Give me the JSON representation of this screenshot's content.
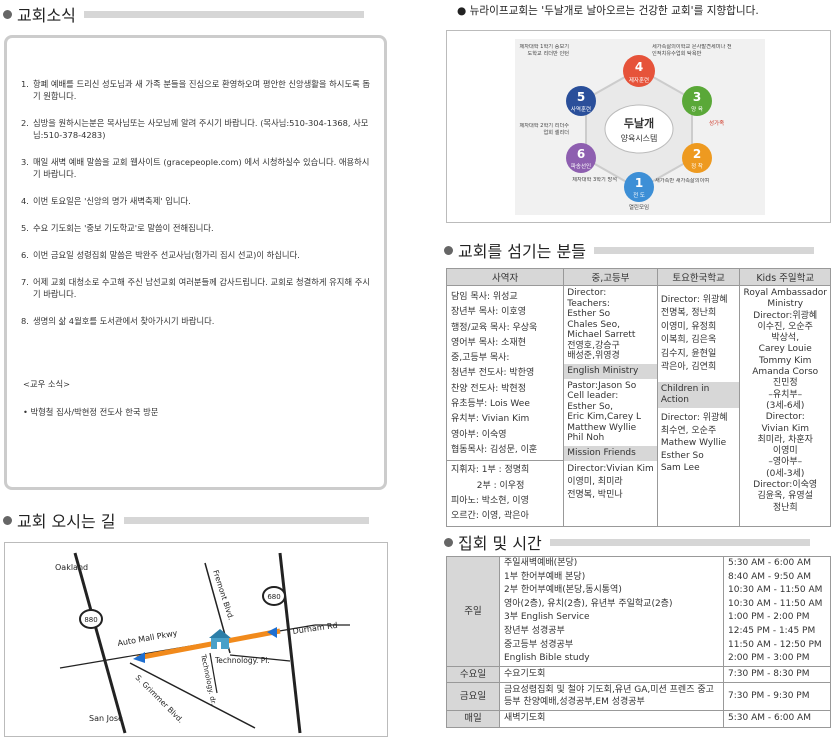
{
  "notices": {
    "title": "교회소식",
    "items": [
      {
        "num": "1.",
        "text": "항폐 예배를 드리신 성도님과 새 가족 분들을 진심으로 환영하오며 평안한 신앙생활을 하시도록 돕기 원합니다."
      },
      {
        "num": "2.",
        "text": "심방을 원하시는분은 목사님또는 사모님께 알려 주시기 바랍니다. (목사님:510-304-1368, 사모님:510-378-4283)"
      },
      {
        "num": "3.",
        "text": "매일 새벽 예배 말씀을 교회 웹사이트 (gracepeople.com) 에서 시청하실수 있습니다. 애용하시기 바랍니다."
      },
      {
        "num": "4.",
        "text": "이번 토요일은 '신앙의 명가 새벽축제' 입니다."
      },
      {
        "num": "5.",
        "text": "수요 기도회는 '중보 기도학교'로 말씀이 전해집니다."
      },
      {
        "num": "6.",
        "text": "이번 금요일 성령집회 말씀은 박완주 선교사님(헝가리 집시 선교)이 하십니다."
      },
      {
        "num": "7.",
        "text": "어제 교회 대청소로 수고해 주신 남선교회 여러분들께 감사드립니다. 교회로 청결하게 유지해 주시기 바랍니다."
      },
      {
        "num": "8.",
        "text": "생명의 삶 4월호를 도서관에서 찾아가시기 바랍니다."
      }
    ],
    "school_heading": "<교우 소식>",
    "school_item": "• 박형철 집사/박현정 전도사 한국 방문"
  },
  "directions": {
    "title": "교회 오시는 길",
    "labels": {
      "oakland": "Oakland",
      "san_jose": "San Jose",
      "fremont": "Fremont Blvd.",
      "auto_mall": "Auto Mall Pkwy",
      "durham": "Durham Rd",
      "technology_pl": "Technology. Pl.",
      "technology_dr": "Technology. dr.",
      "grimmer": "S. Grimmer Blvd.",
      "hwy880": "880",
      "hwy680": "680"
    }
  },
  "vision": {
    "subtitle": "● 뉴라이프교회는 '두날개로 날아오르는 건강한 교회'를 지향합니다.",
    "center_title": "두날개",
    "center_sub": "양육시스템",
    "steps": [
      {
        "num": "1",
        "label": "전 도",
        "desc": "열린모임"
      },
      {
        "num": "2",
        "label": "정 착",
        "desc": "새가족반 새가족삶의이여"
      },
      {
        "num": "3",
        "label": "양 육",
        "desc": "성가족"
      },
      {
        "num": "4",
        "label": "제자훈련",
        "desc": "세가족삶의이학교 은사발견세미나 전인적치유수업회 탁욕반"
      },
      {
        "num": "5",
        "label": "사역훈련",
        "desc": "제자대학 1학기 중보기도학교 리더반 인턴"
      },
      {
        "num": "6",
        "label": "파송선인",
        "desc": "제자대학 2학기 리더수업회 셀리더"
      }
    ],
    "extra": {
      "left_bottom": "제자대학 3학기 방석",
      "right_mid": "성가족"
    }
  },
  "staff": {
    "title": "교회를 섬기는 분들",
    "headers": [
      "사역자",
      "중,고등부",
      "토요한국학교",
      "Kids 주일학교"
    ],
    "ministers": [
      "담임 목사: 위성교",
      "장년부 목사: 이호영",
      "행정/교육 목사: 우상욱",
      "영어부 목사: 소재현",
      "중,고등부 목사:",
      "청년부 전도사: 박한영",
      "찬양 전도사: 박현정",
      "유초등부: Lois Wee",
      "유치부: Vivian Kim",
      "영아부: 이숙영",
      "협동목사: 김성문, 이훈"
    ],
    "evangelists": [
      "지휘자: 1부 : 정명희",
      "         2부 : 이우정",
      "피아노: 박소현, 이영",
      "오르간: 이영, 곽은아"
    ],
    "youth": [
      "Director:",
      "Teachers:",
      "Esther So",
      "Chales Seo,",
      "Michael Sarrett",
      "전영호,강승구",
      "배성준,위영경"
    ],
    "english_ministry_title": "English Ministry",
    "english_ministry": [
      "Pastor:Jason So",
      "Cell leader:",
      "Esther So,",
      "Eric Kim,Carey L",
      "Matthew Wyllie",
      "Phil Noh"
    ],
    "mission_title": "Mission Friends",
    "mission": [
      "Director:Vivian Kim",
      "이영미, 최미라",
      "전명복, 박민나"
    ],
    "korean_school": [
      "Director: 위광혜",
      "전명복, 정난희",
      "이영미, 유정희",
      "이복희, 김은옥",
      "김수지, 윤현일",
      "곽은아, 김연희"
    ],
    "children_action_title": "Children in Action",
    "children_action": [
      "Director: 위광혜",
      "최수연, 오순주",
      "Mathew Wyllie",
      "Esther So",
      "Sam Lee"
    ],
    "kids": [
      "Royal Ambassador",
      "Ministry",
      "Director:위광혜",
      "이수진, 오순주",
      "박상석,",
      "Carey Louie",
      "Tommy Kim",
      "Amanda Corso",
      "진민정",
      "–유치부–",
      "(3세-6세)",
      "Director:",
      "Vivian Kim",
      "최미라, 차훈자",
      "이영미",
      "–영아부–",
      "(0세-3세)",
      "Director:이숙영",
      "김윤옥, 유영설",
      "정난희"
    ]
  },
  "schedule": {
    "title": "집회 및 시간",
    "groups": [
      {
        "category": "주일",
        "rows": [
          {
            "name": "주일새벽예배(본당)",
            "time": "5:30 AM - 6:00 AM"
          },
          {
            "name": "1부 한어부예배 본당)",
            "time": "8:40 AM - 9:50 AM"
          },
          {
            "name": "2부 한어부예배(본당,동시통역)",
            "time": "10:30 AM - 11:50 AM"
          },
          {
            "name": "영아(2층), 유치(2층), 유년부 주일학교(2층)",
            "time": "10:30 AM - 11:50 AM"
          },
          {
            "name": "3부 English Service",
            "time": "1:00 PM - 2:00 PM"
          },
          {
            "name": "장년부 성경공부",
            "time": "12:45 PM - 1:45 PM"
          },
          {
            "name": "중고등부 성경공부",
            "time": "11:50 AM - 12:50 PM"
          },
          {
            "name": "English Bible study",
            "time": "2:00 PM - 3:00 PM"
          }
        ]
      },
      {
        "category": "수요일",
        "rows": [
          {
            "name": "수요기도회",
            "time": "7:30 PM - 8:30 PM"
          }
        ]
      },
      {
        "category": "금요일",
        "rows": [
          {
            "name": "금요성령집회 및 철야 기도회,유년 GA,미션 프렌즈 중고등부 찬양예배,성경공부,EM 성경공부",
            "time": "7:30 PM - 9:30 PM"
          }
        ]
      },
      {
        "category": "매일",
        "rows": [
          {
            "name": "새벽기도회",
            "time": "5:30 AM - 6:00 AM"
          }
        ]
      }
    ]
  }
}
